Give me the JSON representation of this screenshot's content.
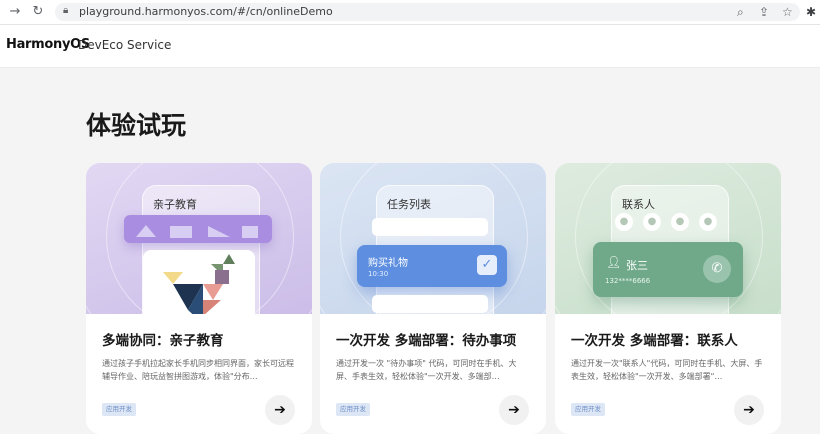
{
  "browser": {
    "url": "playground.harmonyos.com/#/cn/onlineDemo",
    "icons": [
      "back-icon",
      "reload-icon",
      "lock-icon",
      "zoom-icon",
      "share-icon",
      "star-icon",
      "extensions-icon"
    ]
  },
  "header": {
    "logo": "HarmonyOS",
    "service": "DevEco Service"
  },
  "page": {
    "title": "体验试玩"
  },
  "cards": [
    {
      "label": "亲子教育",
      "title": "多端协同：亲子教育",
      "desc": "通过孩子手机拉起家长手机同步相同界面，家长可远程辅导作业、陪玩益智拼图游戏，体验\"分布…",
      "tag": "应用开发",
      "bg": "#d9cfee"
    },
    {
      "label": "任务列表",
      "task_name": "购买礼物",
      "task_time": "10:30",
      "title": "一次开发 多端部署：待办事项",
      "desc": "通过开发一次 \"待办事项\" 代码，可同时在手机、大屏、手表生效，轻松体验\"一次开发、多端部…",
      "tag": "应用开发",
      "bg": "#d3dff0"
    },
    {
      "label": "联系人",
      "contact_name": "张三",
      "contact_phone": "132****6666",
      "title": "一次开发 多端部署：联系人",
      "desc": "通过开发一次\"联系人\"代码，可同时在手机、大屏、手表生效，轻松体验\"一次开发、多端部署\"…",
      "tag": "应用开发",
      "bg": "#d6e7d8"
    }
  ]
}
